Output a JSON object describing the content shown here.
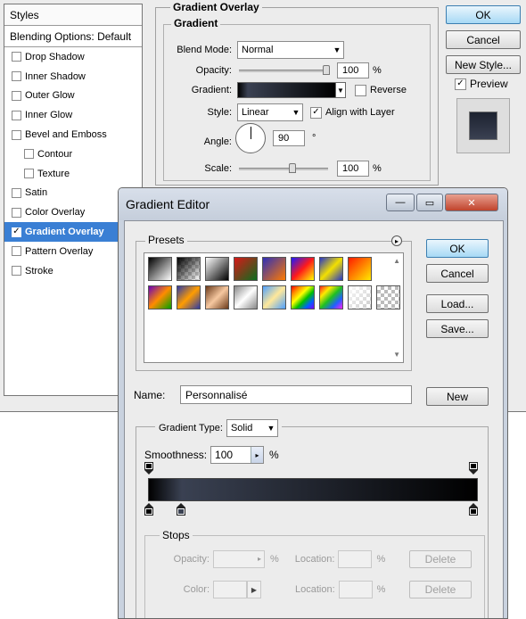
{
  "layer_style": {
    "styles_header": "Styles",
    "blending_options": "Blending Options: Default",
    "items": [
      {
        "label": "Drop Shadow",
        "checked": false
      },
      {
        "label": "Inner Shadow",
        "checked": false
      },
      {
        "label": "Outer Glow",
        "checked": false
      },
      {
        "label": "Inner Glow",
        "checked": false
      },
      {
        "label": "Bevel and Emboss",
        "checked": false
      },
      {
        "label": "Contour",
        "checked": false
      },
      {
        "label": "Texture",
        "checked": false
      },
      {
        "label": "Satin",
        "checked": false
      },
      {
        "label": "Color Overlay",
        "checked": false
      },
      {
        "label": "Gradient Overlay",
        "checked": true
      },
      {
        "label": "Pattern Overlay",
        "checked": false
      },
      {
        "label": "Stroke",
        "checked": false
      }
    ],
    "section_title": "Gradient Overlay",
    "sub_title": "Gradient",
    "blend_mode_label": "Blend Mode:",
    "blend_mode_value": "Normal",
    "opacity_label": "Opacity:",
    "opacity_value": "100",
    "opacity_unit": "%",
    "gradient_label": "Gradient:",
    "reverse_label": "Reverse",
    "style_label": "Style:",
    "style_value": "Linear",
    "align_label": "Align with Layer",
    "angle_label": "Angle:",
    "angle_value": "90",
    "angle_unit": "°",
    "scale_label": "Scale:",
    "scale_value": "100",
    "scale_unit": "%",
    "ok": "OK",
    "cancel": "Cancel",
    "new_style": "New Style...",
    "preview": "Preview",
    "check_glyph": "✓"
  },
  "editor": {
    "title": "Gradient Editor",
    "presets_label": "Presets",
    "ok": "OK",
    "cancel": "Cancel",
    "load": "Load...",
    "save": "Save...",
    "name_label": "Name:",
    "name_value": "Personnalisé",
    "new": "New",
    "gradient_type_label": "Gradient Type:",
    "gradient_type_value": "Solid",
    "smoothness_label": "Smoothness:",
    "smoothness_value": "100",
    "smoothness_unit": "%",
    "stops_label": "Stops",
    "opacity_label": "Opacity:",
    "percent": "%",
    "location_label": "Location:",
    "delete": "Delete",
    "color_label": "Color:",
    "gradient_colors": [
      "#000000",
      "#3a4152",
      "#000000"
    ],
    "stop_colors": [
      "#000000",
      "#3a4152",
      "#000000"
    ]
  }
}
